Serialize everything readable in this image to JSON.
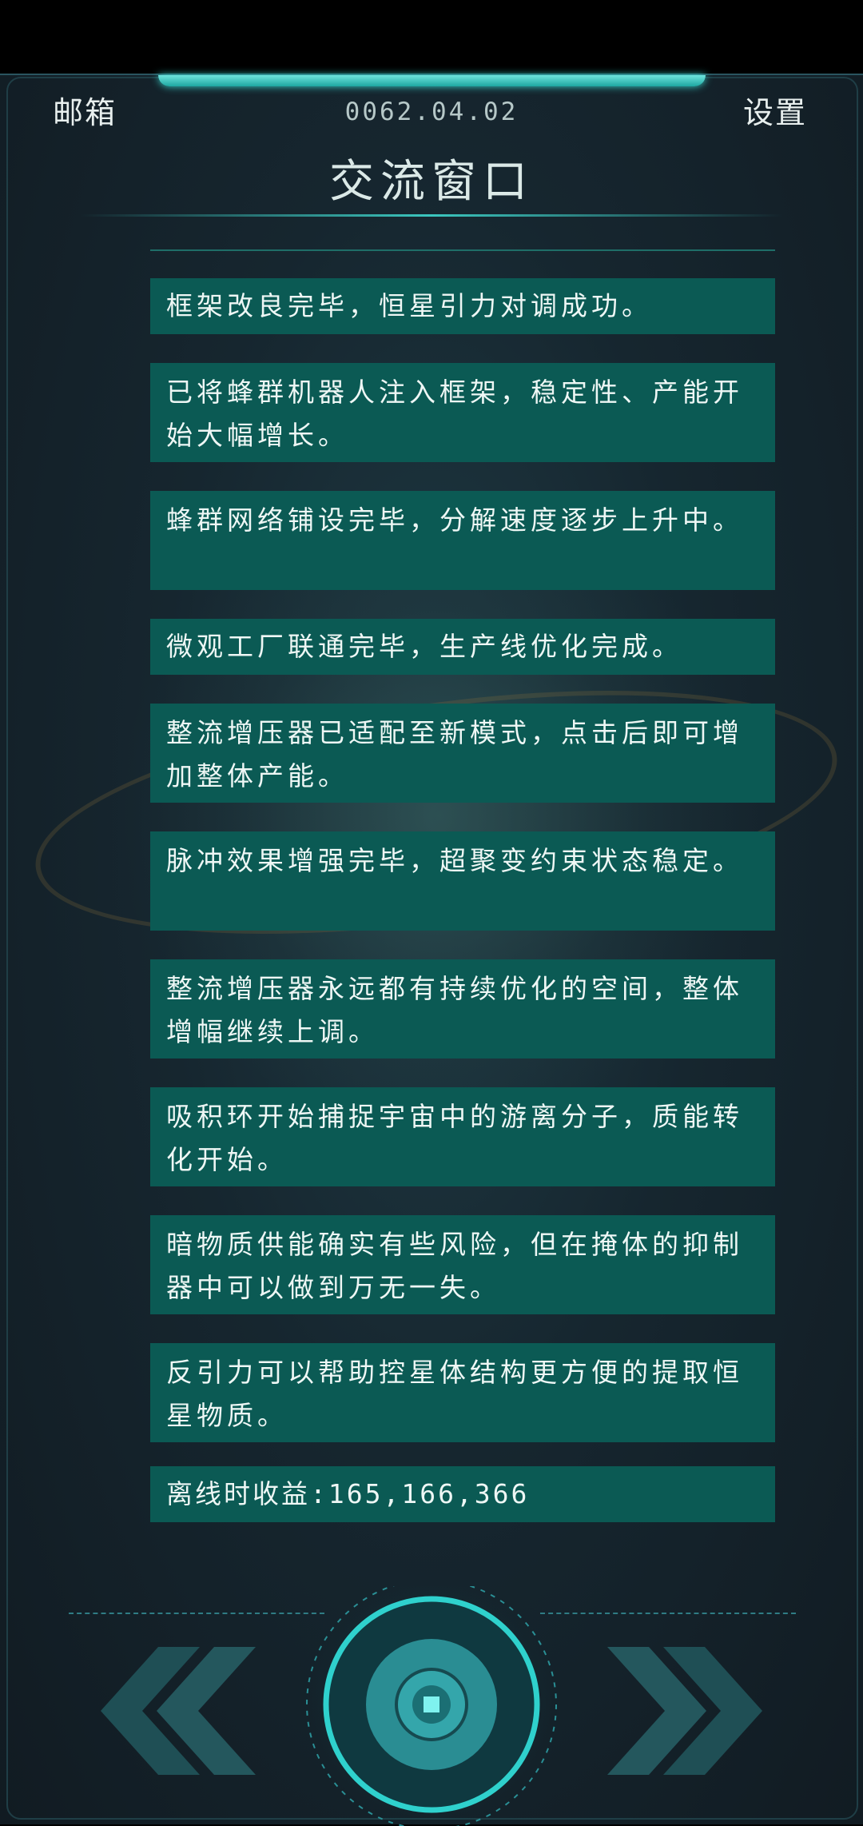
{
  "header": {
    "mail_label": "邮箱",
    "date": "0062.04.02",
    "settings_label": "设置"
  },
  "window_title": "交流窗口",
  "messages": [
    "框架改良完毕，恒星引力对调成功。",
    "已将蜂群机器人注入框架，稳定性、产能开始大幅增长。",
    "蜂群网络铺设完毕，分解速度逐步上升中。",
    "微观工厂联通完毕，生产线优化完成。",
    "整流增压器已适配至新模式，点击后即可增加整体产能。",
    "脉冲效果增强完毕，超聚变约束状态稳定。",
    "整流增压器永远都有持续优化的空间，整体增幅继续上调。",
    "吸积环开始捕捉宇宙中的游离分子，质能转化开始。",
    "暗物质供能确实有些风险，但在掩体的抑制器中可以做到万无一失。",
    "反引力可以帮助控星体结构更方便的提取恒星物质。"
  ],
  "income": "离线时收益:165,166,366",
  "nav": {
    "prev_icon": "double-chevron-left-icon",
    "center_icon": "core-button-icon",
    "next_icon": "double-chevron-right-icon"
  },
  "colors": {
    "accent": "#37d6cf",
    "message_bg": "#0b5a54",
    "frame_bg": "#16262f"
  }
}
